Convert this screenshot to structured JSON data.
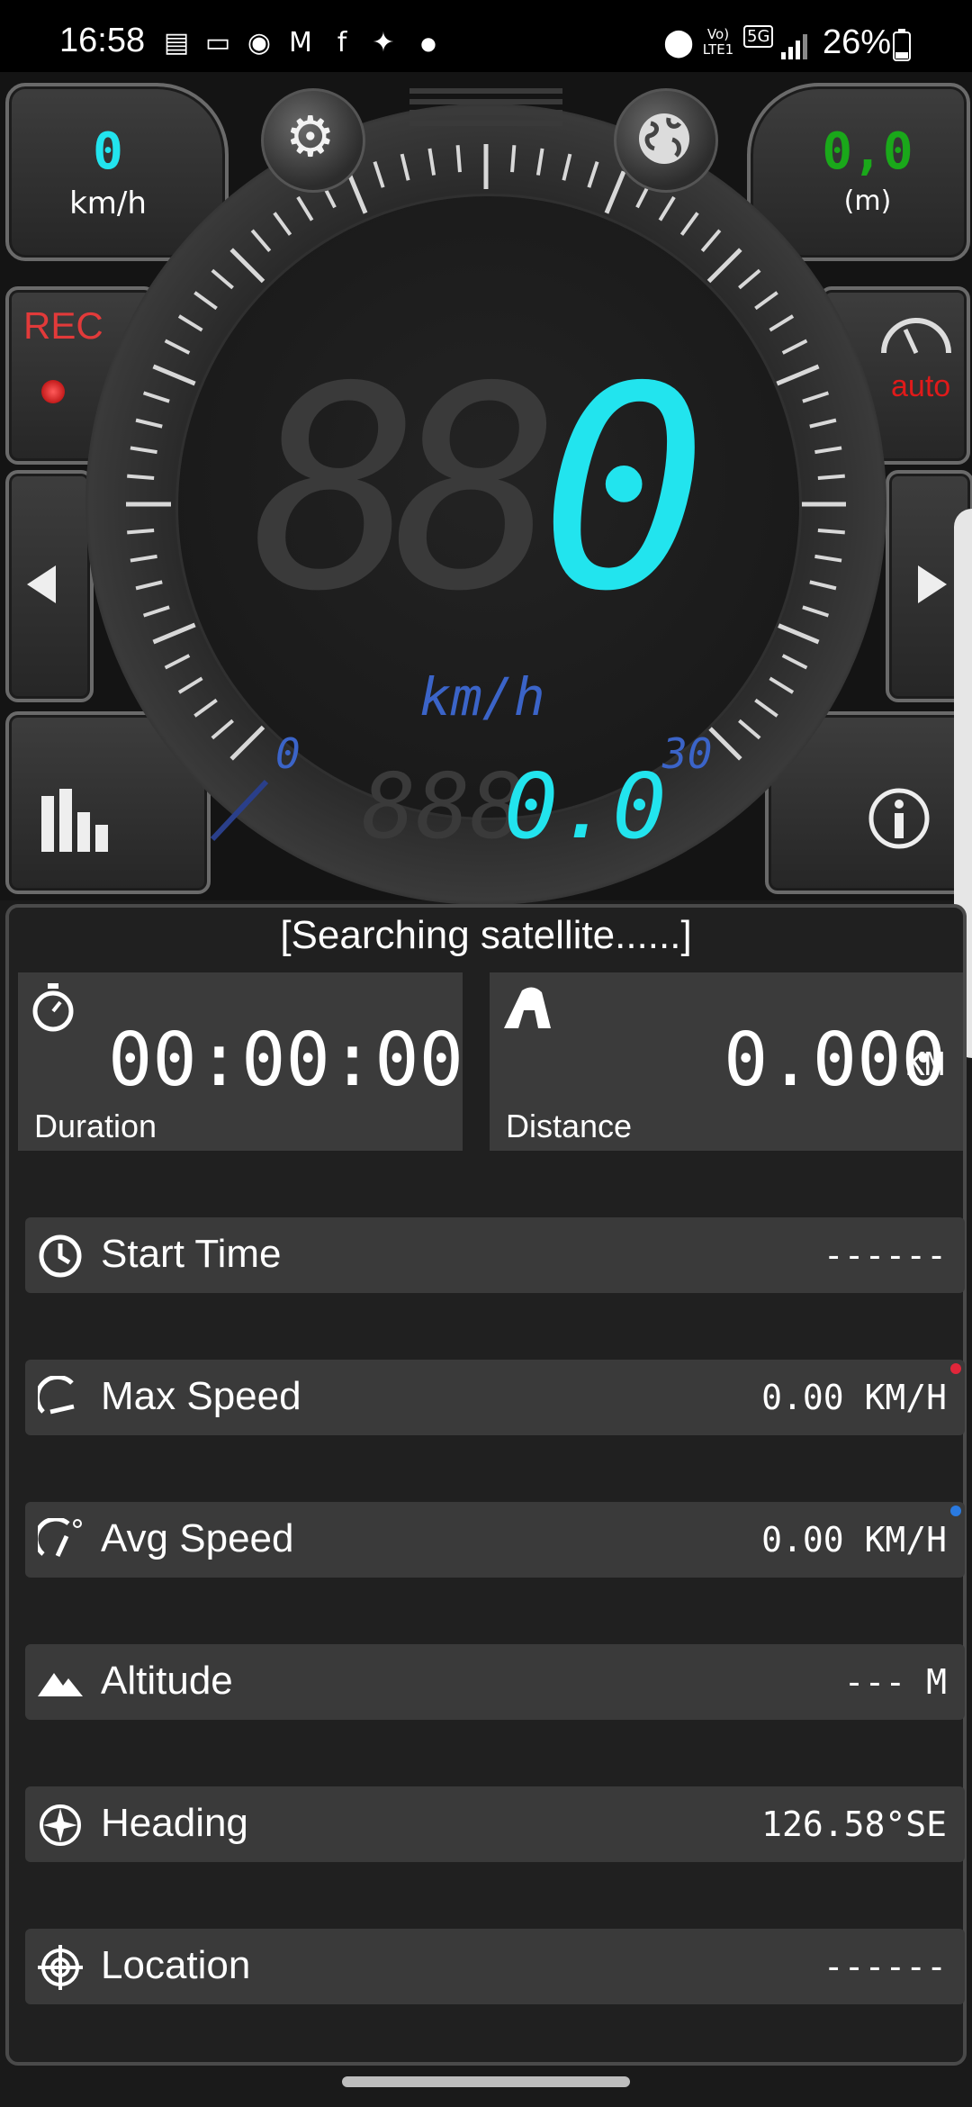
{
  "status_bar": {
    "time": "16:58",
    "network": "Vo) LTE1",
    "network_type": "5G",
    "battery": "26%"
  },
  "gauge": {
    "speed_corner_value": "0",
    "speed_corner_unit": "km/h",
    "altitude_corner_value": "0,0",
    "altitude_corner_unit": "(m)",
    "rec_label": "REC",
    "auto_label": "auto",
    "ghost_digits": "88",
    "speed_digit": "0",
    "speed_unit": "km/h",
    "scale_min": "0",
    "scale_max": "30",
    "odometer_ghost": "888",
    "odometer_value": "0.0",
    "colors": {
      "cyan": "#22e4ee",
      "green": "#1aa81a",
      "rec_red": "#e23a3a",
      "auto_red": "#e01a1a"
    }
  },
  "panel": {
    "status_message": "[Searching satellite......]",
    "duration": {
      "value": "00:00:00",
      "label": "Duration"
    },
    "distance": {
      "value": "0.000",
      "unit": "KM",
      "label": "Distance"
    },
    "rows": [
      {
        "label": "Start Time",
        "value": "------",
        "icon": "clock-icon"
      },
      {
        "label": "Max Speed",
        "value": "0.00 KM/H",
        "icon": "speedometer-icon"
      },
      {
        "label": "Avg Speed",
        "value": "0.00 KM/H",
        "icon": "avg-speedometer-icon"
      },
      {
        "label": "Altitude",
        "value": "--- M",
        "icon": "mountain-icon"
      },
      {
        "label": "Heading",
        "value": "126.58°SE",
        "icon": "compass-icon"
      },
      {
        "label": "Location",
        "value": "------",
        "icon": "crosshair-icon"
      }
    ]
  }
}
